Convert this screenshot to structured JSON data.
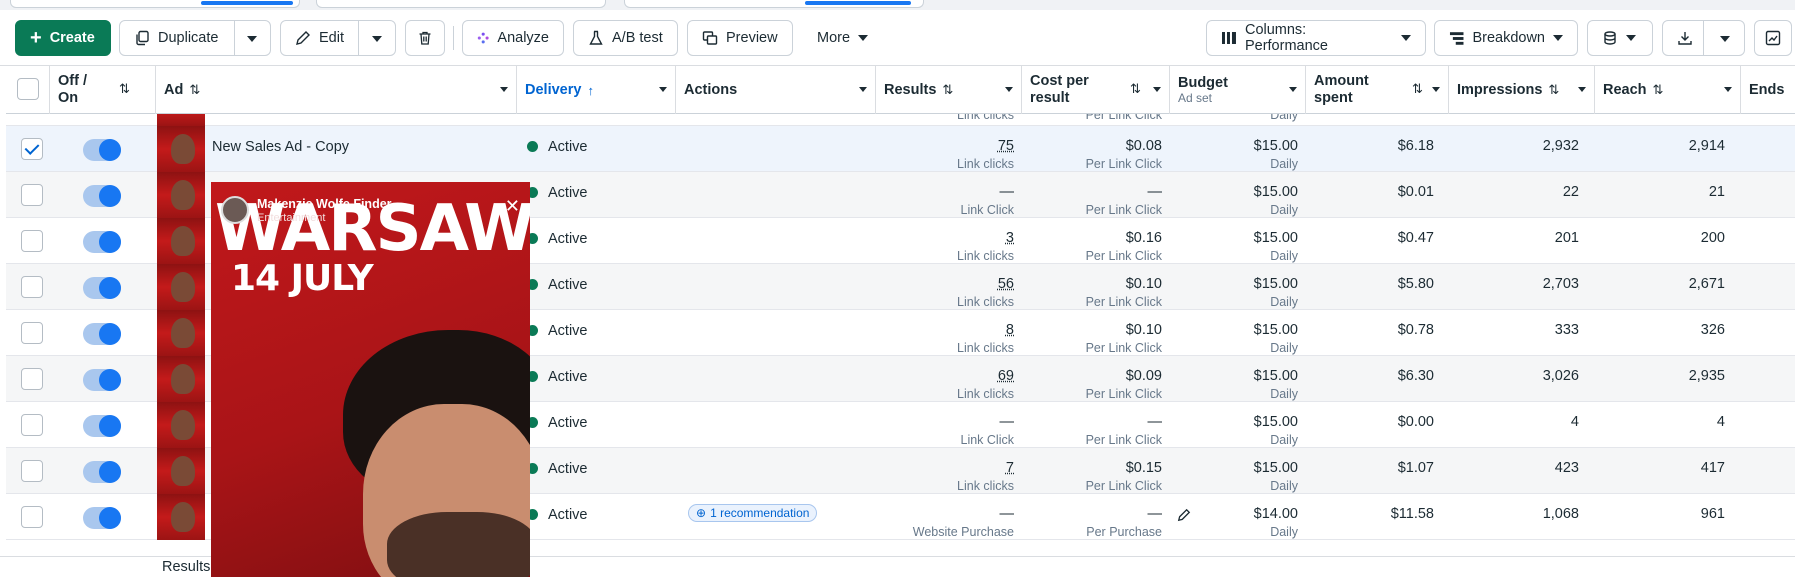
{
  "toolbar": {
    "create": "Create",
    "duplicate": "Duplicate",
    "edit": "Edit",
    "analyze": "Analyze",
    "ab_test": "A/B test",
    "preview": "Preview",
    "more": "More",
    "columns": "Columns: Performance",
    "breakdown": "Breakdown"
  },
  "headers": {
    "off_on": "Off / On",
    "ad": "Ad",
    "delivery": "Delivery",
    "actions": "Actions",
    "results": "Results",
    "cost_per_result": "Cost per result",
    "budget": "Budget",
    "budget_sub": "Ad set",
    "amount_spent": "Amount spent",
    "impressions": "Impressions",
    "reach": "Reach",
    "ends": "Ends"
  },
  "partial_top": {
    "results_sub": "Link clicks",
    "cost_sub": "Per Link Click",
    "budget_sub": "Daily"
  },
  "rows": [
    {
      "name": "New Sales Ad - Copy",
      "delivery": "Active",
      "results": "75",
      "results_sub": "Link clicks",
      "cost": "$0.08",
      "cost_sub": "Per Link Click",
      "budget": "$15.00",
      "budget_sub": "Daily",
      "spent": "$6.18",
      "impressions": "2,932",
      "reach": "2,914"
    },
    {
      "name": "",
      "delivery": "Active",
      "results": "—",
      "results_sub": "Link Click",
      "cost": "—",
      "cost_sub": "Per Link Click",
      "budget": "$15.00",
      "budget_sub": "Daily",
      "spent": "$0.01",
      "impressions": "22",
      "reach": "21"
    },
    {
      "name": "",
      "delivery": "Active",
      "results": "3",
      "results_sub": "Link clicks",
      "cost": "$0.16",
      "cost_sub": "Per Link Click",
      "budget": "$15.00",
      "budget_sub": "Daily",
      "spent": "$0.47",
      "impressions": "201",
      "reach": "200"
    },
    {
      "name": "",
      "delivery": "Active",
      "results": "56",
      "results_sub": "Link clicks",
      "cost": "$0.10",
      "cost_sub": "Per Link Click",
      "budget": "$15.00",
      "budget_sub": "Daily",
      "spent": "$5.80",
      "impressions": "2,703",
      "reach": "2,671"
    },
    {
      "name": "",
      "delivery": "Active",
      "results": "8",
      "results_sub": "Link clicks",
      "cost": "$0.10",
      "cost_sub": "Per Link Click",
      "budget": "$15.00",
      "budget_sub": "Daily",
      "spent": "$0.78",
      "impressions": "333",
      "reach": "326"
    },
    {
      "name": "",
      "delivery": "Active",
      "results": "69",
      "results_sub": "Link clicks",
      "cost": "$0.09",
      "cost_sub": "Per Link Click",
      "budget": "$15.00",
      "budget_sub": "Daily",
      "spent": "$6.30",
      "impressions": "3,026",
      "reach": "2,935"
    },
    {
      "name": "",
      "delivery": "Active",
      "results": "—",
      "results_sub": "Link Click",
      "cost": "—",
      "cost_sub": "Per Link Click",
      "budget": "$15.00",
      "budget_sub": "Daily",
      "spent": "$0.00",
      "impressions": "4",
      "reach": "4"
    },
    {
      "name": "",
      "delivery": "Active",
      "results": "7",
      "results_sub": "Link clicks",
      "cost": "$0.15",
      "cost_sub": "Per Link Click",
      "budget": "$15.00",
      "budget_sub": "Daily",
      "spent": "$1.07",
      "impressions": "423",
      "reach": "417"
    },
    {
      "name": "",
      "delivery": "Active",
      "results": "—",
      "results_sub": "Website Purchase",
      "cost": "—",
      "cost_sub": "Per Purchase",
      "budget": "$14.00",
      "budget_sub": "Daily",
      "spent": "$11.58",
      "impressions": "1,068",
      "reach": "961",
      "recommendation": "1 recommendation"
    }
  ],
  "footer": {
    "label": "Results"
  },
  "preview": {
    "headline": "WARSAW",
    "date": "14 JULY",
    "page_name": "Makenzie Wolfe Finder",
    "page_sub": "Entertainment"
  },
  "colors": {
    "primary": "#0a7a56",
    "accent": "#1877f2",
    "link": "#0064d1"
  }
}
